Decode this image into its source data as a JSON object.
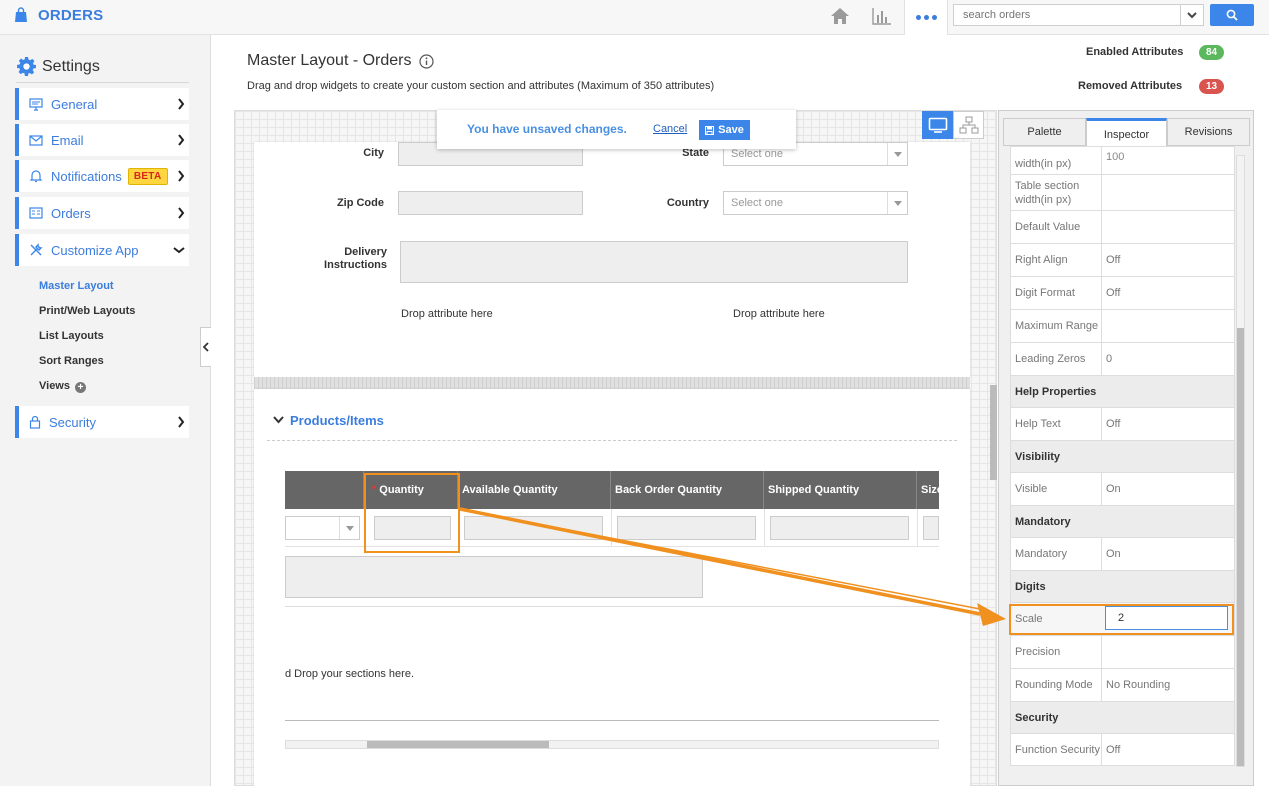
{
  "app": {
    "title": "ORDERS"
  },
  "topbar": {
    "home_icon": "home-icon",
    "reports_icon": "bar-chart-icon",
    "more_icon": "more-dots-icon",
    "search_placeholder": "search orders",
    "search_icon": "search-icon"
  },
  "sidebar": {
    "title": "Settings",
    "items": [
      {
        "label": "General",
        "icon": "monitor-icon"
      },
      {
        "label": "Email",
        "icon": "envelope-icon"
      },
      {
        "label": "Notifications",
        "icon": "bell-icon",
        "badge": "BETA"
      },
      {
        "label": "Orders",
        "icon": "list-icon"
      },
      {
        "label": "Customize App",
        "icon": "tools-icon"
      },
      {
        "label": "Security",
        "icon": "lock-icon"
      }
    ],
    "subitems": [
      "Master Layout",
      "Print/Web Layouts",
      "List Layouts",
      "Sort Ranges",
      "Views"
    ]
  },
  "header": {
    "title": "Master Layout - Orders",
    "subtitle": "Drag and drop widgets to create your custom section and attributes (Maximum of 350 attributes)",
    "enabled_label": "Enabled Attributes",
    "enabled_count": "84",
    "removed_label": "Removed Attributes",
    "removed_count": "13"
  },
  "toast": {
    "message": "You have unsaved changes.",
    "cancel": "Cancel",
    "save": "Save"
  },
  "form": {
    "city": "City",
    "state": "State",
    "state_placeholder": "Select one",
    "zip": "Zip Code",
    "country": "Country",
    "country_placeholder": "Select one",
    "delivery_line1": "Delivery",
    "delivery_line2": "Instructions",
    "drop_left": "Drop attribute here",
    "drop_right": "Drop attribute here"
  },
  "products": {
    "section_title": "Products/Items",
    "columns": [
      "Quantity",
      "Available Quantity",
      "Back Order Quantity",
      "Shipped Quantity",
      "Size"
    ],
    "drop_sections": "d Drop your sections here."
  },
  "panel": {
    "tabs": [
      "Palette",
      "Inspector",
      "Revisions"
    ],
    "rows": [
      {
        "key": "width(in px)",
        "value": "100"
      },
      {
        "key": "Table section width(in px)",
        "value": ""
      },
      {
        "key": "Default Value",
        "value": ""
      },
      {
        "key": "Right Align",
        "value": "Off"
      },
      {
        "key": "Digit Format",
        "value": "Off"
      },
      {
        "key": "Maximum Range",
        "value": ""
      },
      {
        "key": "Leading Zeros",
        "value": "0"
      },
      {
        "group": "Help Properties"
      },
      {
        "key": "Help Text",
        "value": "Off"
      },
      {
        "group": "Visibility"
      },
      {
        "key": "Visible",
        "value": "On"
      },
      {
        "group": "Mandatory"
      },
      {
        "key": "Mandatory",
        "value": "On"
      },
      {
        "group": "Digits"
      },
      {
        "key": "Scale",
        "value": "2"
      },
      {
        "key": "Precision",
        "value": ""
      },
      {
        "key": "Rounding Mode",
        "value": "No Rounding"
      },
      {
        "group": "Security"
      },
      {
        "key": "Function Security",
        "value": "Off"
      }
    ]
  },
  "colors": {
    "accent": "#3b86e8",
    "enabled_badge": "#5cb85c",
    "removed_badge": "#d9534f",
    "highlight": "#f0901e"
  }
}
